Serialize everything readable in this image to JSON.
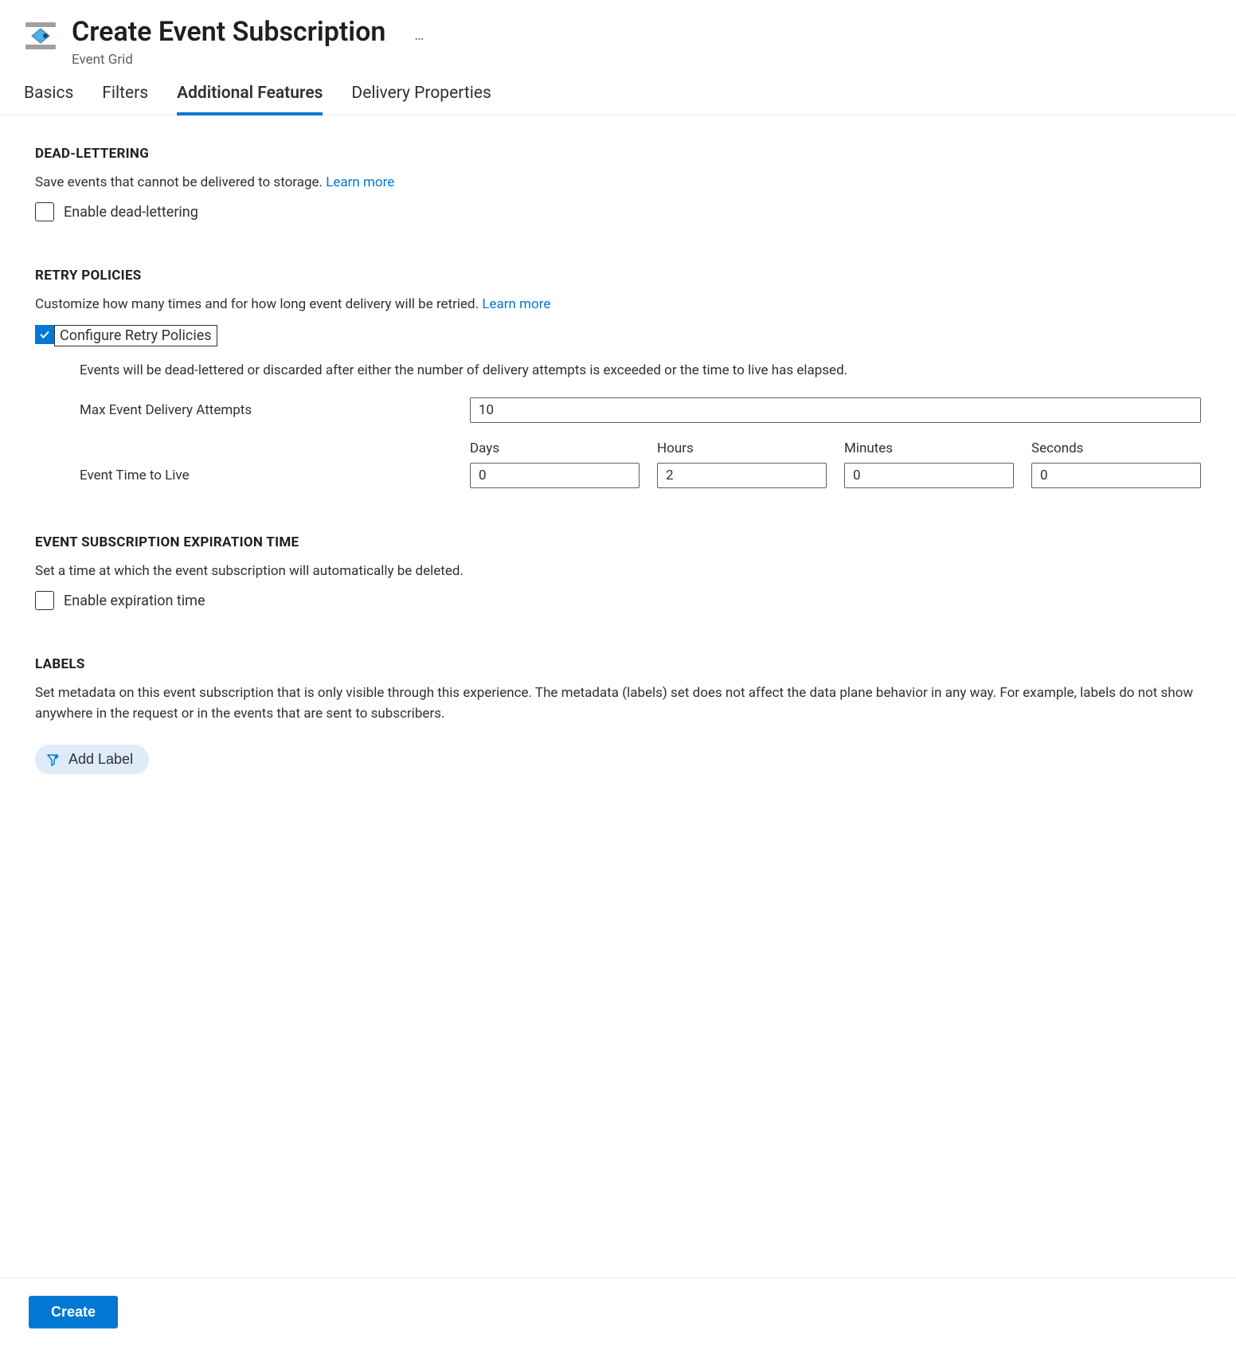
{
  "header": {
    "title": "Create Event Subscription",
    "subtitle": "Event Grid",
    "ellipsis": "…"
  },
  "tabs": [
    {
      "label": "Basics",
      "active": false
    },
    {
      "label": "Filters",
      "active": false
    },
    {
      "label": "Additional Features",
      "active": true
    },
    {
      "label": "Delivery Properties",
      "active": false
    }
  ],
  "dead_lettering": {
    "title": "DEAD-LETTERING",
    "desc": "Save events that cannot be delivered to storage. ",
    "learn_more": "Learn more",
    "checkbox_label": "Enable dead-lettering",
    "checked": false
  },
  "retry": {
    "title": "RETRY POLICIES",
    "desc": "Customize how many times and for how long event delivery will be retried. ",
    "learn_more": "Learn more",
    "checkbox_label": "Configure Retry Policies",
    "checked": true,
    "note": "Events will be dead-lettered or discarded after either the number of delivery attempts is exceeded or the time to live has elapsed.",
    "max_attempts_label": "Max Event Delivery Attempts",
    "max_attempts_value": "10",
    "ttl_label": "Event Time to Live",
    "ttl": {
      "days_label": "Days",
      "days": "0",
      "hours_label": "Hours",
      "hours": "2",
      "minutes_label": "Minutes",
      "minutes": "0",
      "seconds_label": "Seconds",
      "seconds": "0"
    }
  },
  "expiration": {
    "title": "EVENT SUBSCRIPTION EXPIRATION TIME",
    "desc": "Set a time at which the event subscription will automatically be deleted.",
    "checkbox_label": "Enable expiration time",
    "checked": false
  },
  "labels": {
    "title": "LABELS",
    "desc": "Set metadata on this event subscription that is only visible through this experience. The metadata (labels) set does not affect the data plane behavior in any way. For example, labels do not show anywhere in the request or in the events that are sent to subscribers.",
    "add_button": "Add Label"
  },
  "footer": {
    "create": "Create"
  }
}
